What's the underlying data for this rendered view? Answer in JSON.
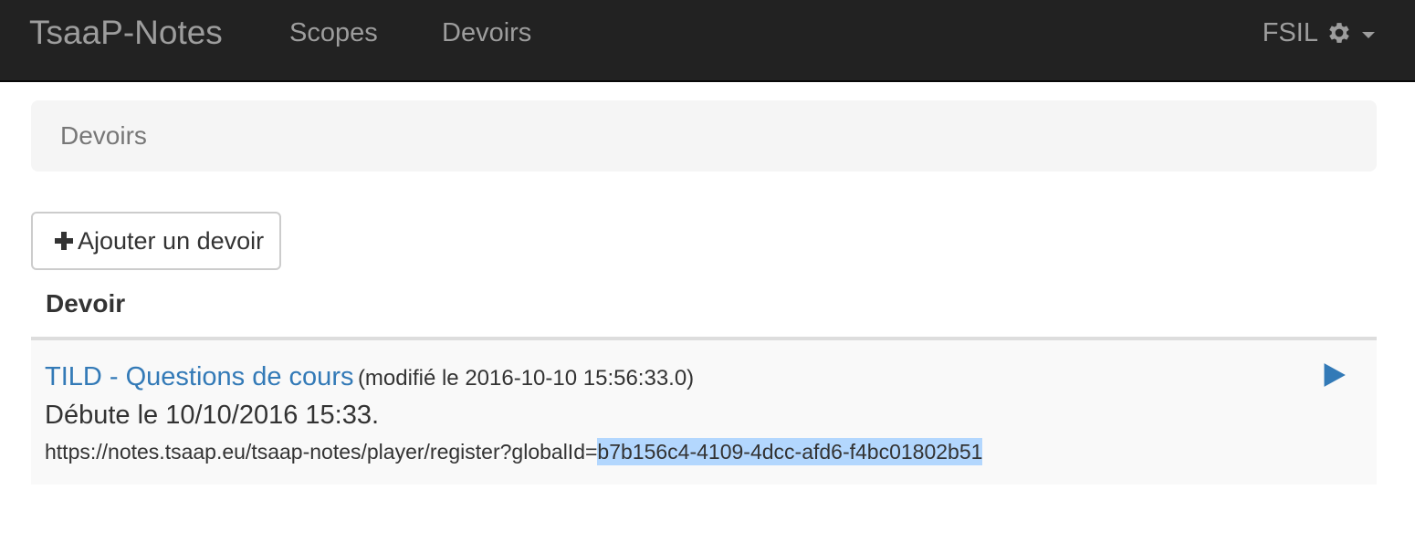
{
  "navbar": {
    "brand": "TsaaP-Notes",
    "links": [
      "Scopes",
      "Devoirs"
    ],
    "user": "FSIL",
    "icons": {
      "settings": "gear-icon",
      "dropdown": "caret-down-icon"
    }
  },
  "breadcrumb": {
    "current": "Devoirs"
  },
  "toolbar": {
    "add_label": "Ajouter un devoir",
    "add_icon": "plus-icon"
  },
  "table": {
    "header": "Devoir",
    "rows": [
      {
        "title": "TILD - Questions de cours",
        "modified": "(modifié le 2016-10-10 15:56:33.0)",
        "start": "Débute le 10/10/2016 15:33.",
        "url_prefix": "https://notes.tsaap.eu/tsaap-notes/player/register?globalId=",
        "url_id": "b7b156c4-4109-4dcc-afd6-f4bc01802b51",
        "action_icon": "play-icon"
      }
    ]
  },
  "colors": {
    "navbar_bg": "#222222",
    "link": "#337ab7",
    "selection": "#b3d7fe",
    "row_bg": "#f9f9f9"
  }
}
